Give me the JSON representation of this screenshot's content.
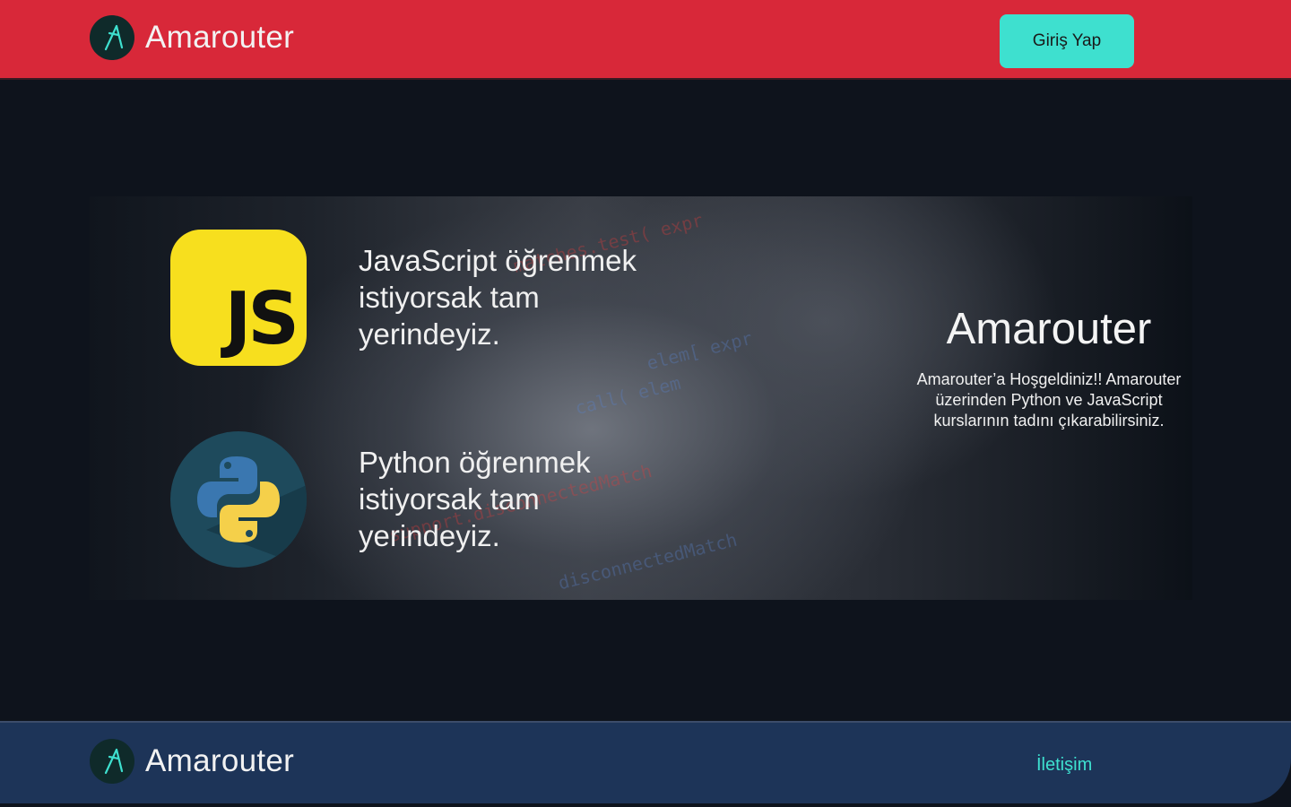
{
  "header": {
    "brand_name": "Amarouter",
    "login_label": "Giriş Yap"
  },
  "hero": {
    "js_badge": "JS",
    "js_line": "JavaScript öğrenmek istiyorsak tam yerindeyiz.",
    "py_line": "Python öğrenmek istiyorsak tam yerindeyiz.",
    "title": "Amarouter",
    "description": "Amarouter’a Hoşgeldiniz!! Amarouter üzerinden Python ve JavaScript kurslarının tadını çıkarabilirsiniz.",
    "code_snippets": [
      "matches.test( expr",
      "elem[ expr",
      "call( elem",
      "support.disconnectedMatch",
      "disconnectedMatch"
    ]
  },
  "footer": {
    "brand_name": "Amarouter",
    "contact_label": "İletişim"
  },
  "colors": {
    "header_bg": "#d82839",
    "accent": "#3ee0cf",
    "page_bg": "#0e131c",
    "footer_bg": "#1d3458"
  }
}
